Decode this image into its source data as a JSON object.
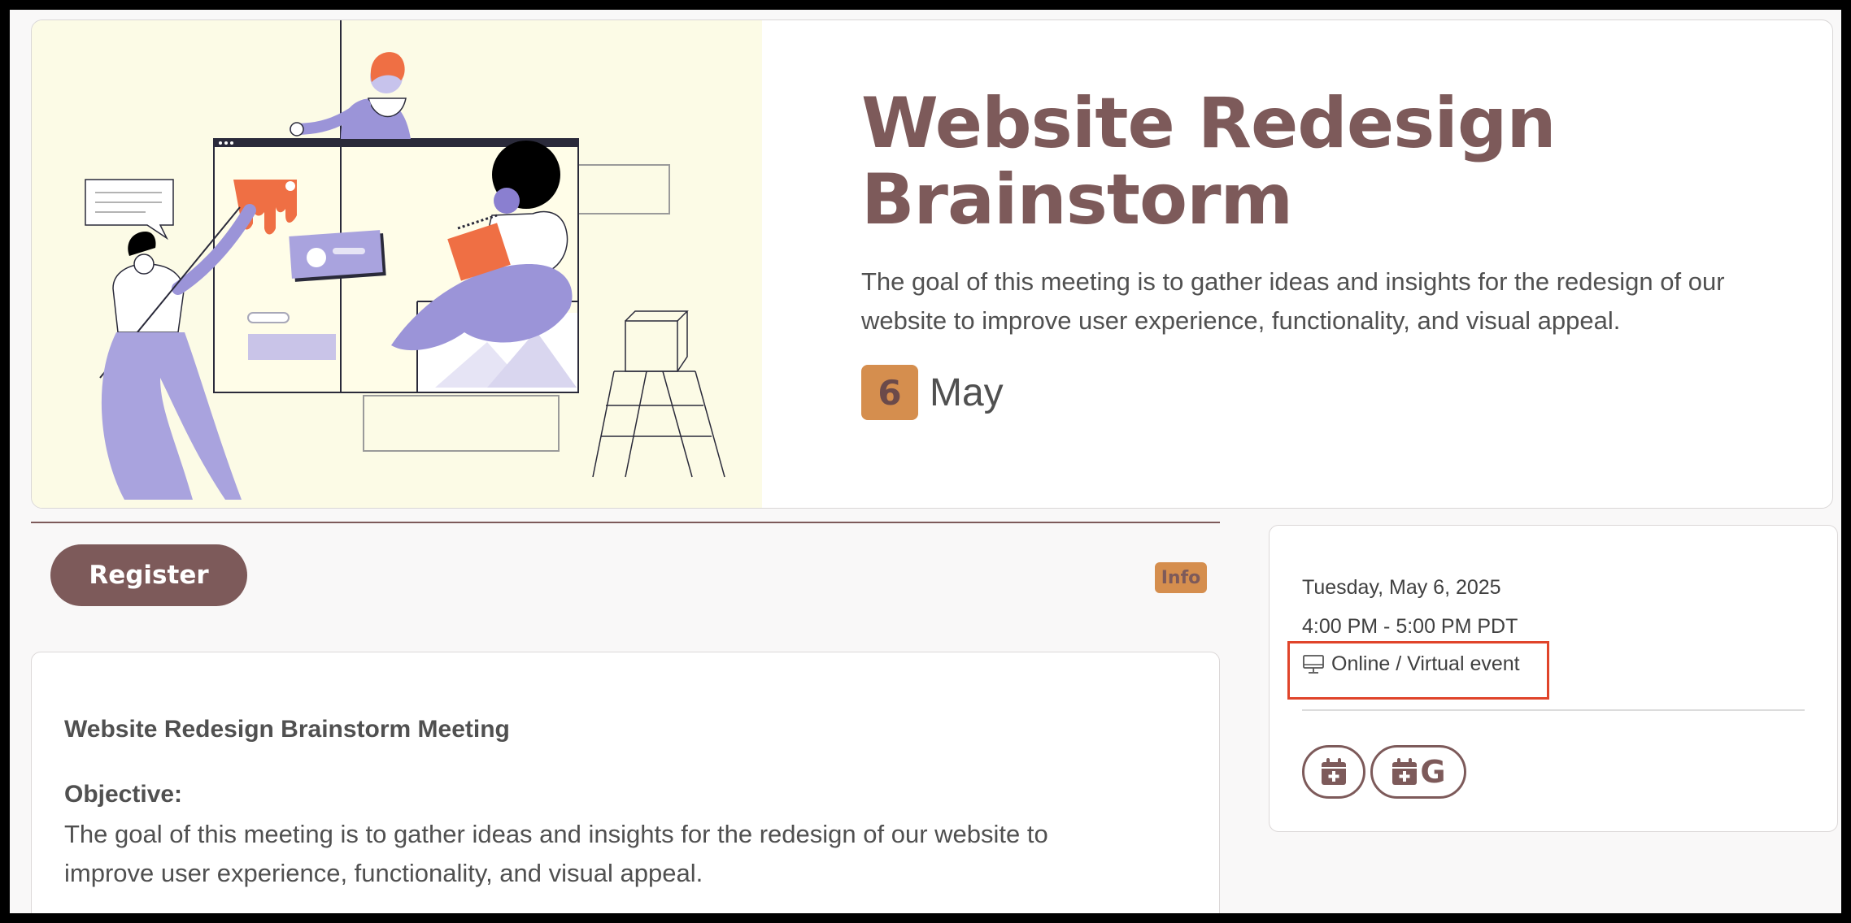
{
  "event": {
    "title": "Website Redesign Brainstorm",
    "description": "The goal of this meeting is to gather ideas and insights for the redesign of our website to improve user experience, functionality, and visual appeal.",
    "day": "6",
    "month": "May"
  },
  "actions": {
    "register_label": "Register",
    "info_label": "Info"
  },
  "details": {
    "heading": "Website Redesign Brainstorm Meeting",
    "objective_label": "Objective:",
    "objective_text": "The goal of this meeting is to gather ideas and insights for the redesign of our website to improve user experience, functionality, and visual appeal."
  },
  "sidebar": {
    "date": "Tuesday, May 6, 2025",
    "time": "4:00 PM - 5:00 PM PDT",
    "location": "Online / Virtual event",
    "location_icon": "monitor-icon",
    "add_calendar_icon": "calendar-plus-icon",
    "google_calendar_letter": "G"
  },
  "colors": {
    "brand": "#7d5a5a",
    "accent": "#d58e4e",
    "highlight": "#e0442a",
    "hero_bg": "#fcfbe6"
  }
}
